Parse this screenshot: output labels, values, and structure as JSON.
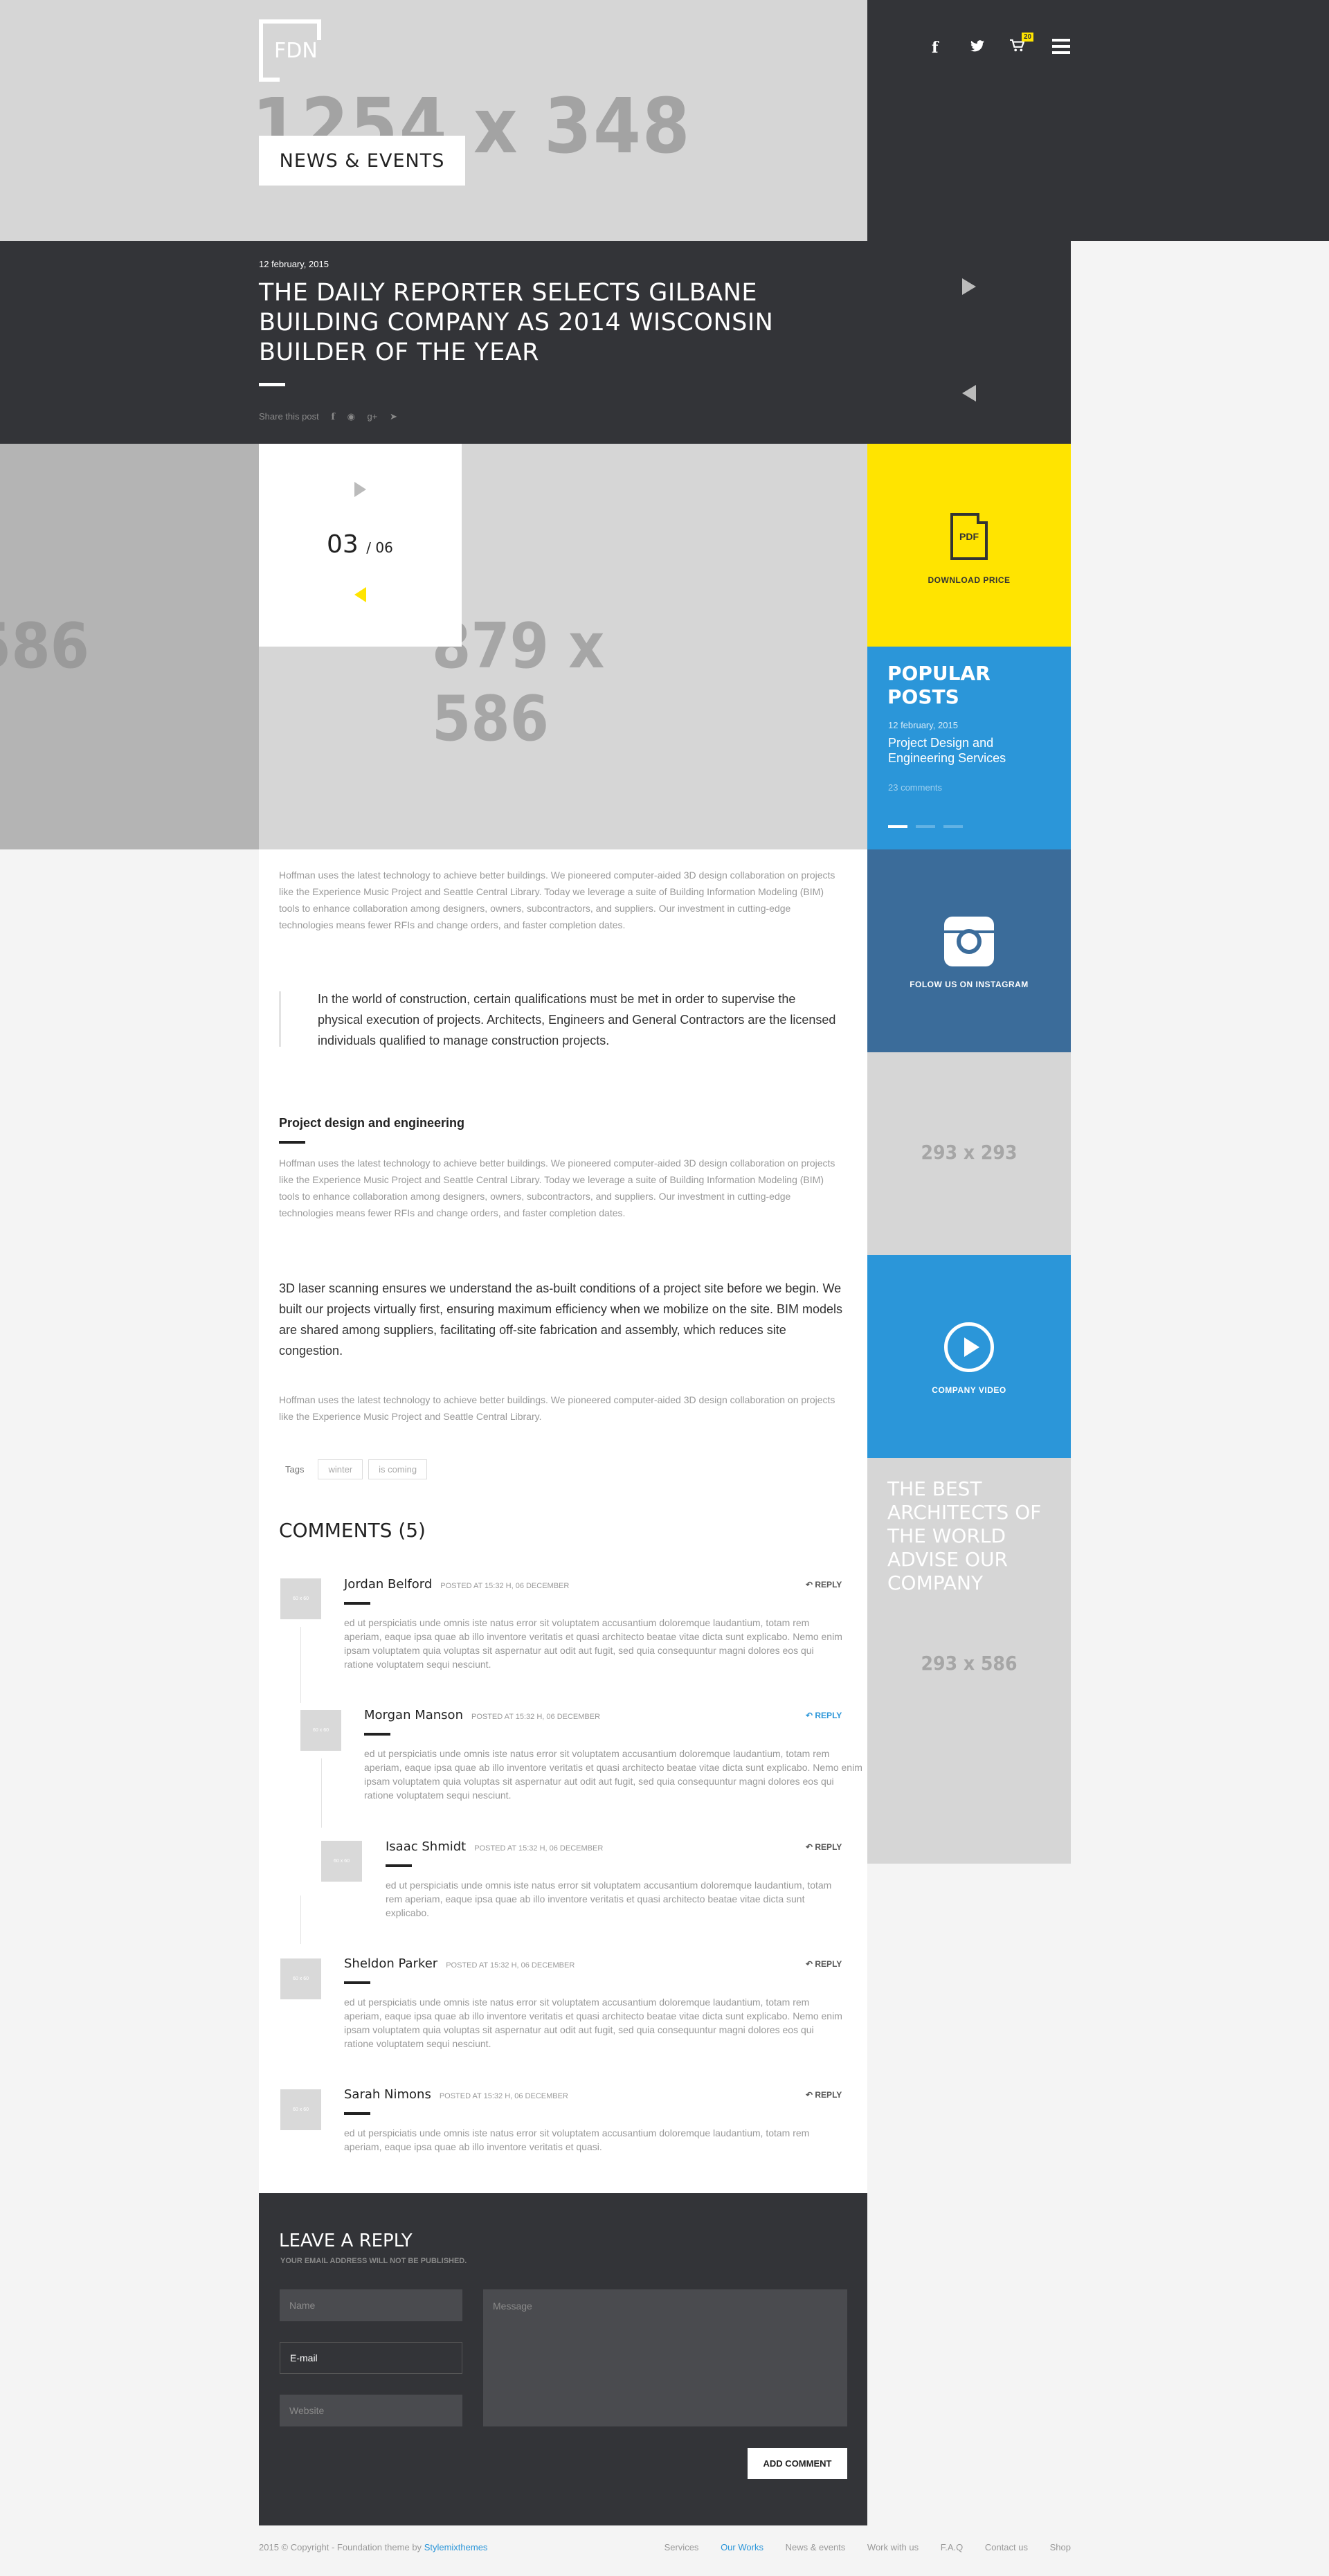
{
  "header": {
    "logo_text": "FDN",
    "hero_placeholder": "1254 x 348",
    "section_title": "NEWS & EVENTS",
    "cart_count": "20"
  },
  "post": {
    "date": "12 february, 2015",
    "title": "THE DAILY REPORTER SELECTS GILBANE BUILDING COMPANY AS 2014 WISCONSIN BUILDER OF THE YEAR",
    "share_label": "Share this post"
  },
  "gallery": {
    "left_placeholder": "586",
    "main_placeholder": "879 x 586",
    "counter_current": "03",
    "counter_total": "/ 06"
  },
  "sidebar": {
    "download_label": "DOWNLOAD PRICE",
    "pdf_label": "PDF",
    "popular_title_1": "POPULAR",
    "popular_title_2": "POSTS",
    "popular_date": "12 february, 2015",
    "popular_post": "Project Design and Engineering Services",
    "popular_comments": "23 comments",
    "instagram_label": "FOLOW US ON INSTAGRAM",
    "placeholder_1": "293 x 293",
    "video_label": "COMPANY VIDEO",
    "best_text": "THE BEST ARCHITECTS OF THE WORLD ADVISE OUR COMPANY",
    "placeholder_2": "293 x 586"
  },
  "article": {
    "p1": "Hoffman uses the latest technology to achieve better buildings. We pioneered computer-aided 3D design collaboration on projects like the Experience Music Project and Seattle Central Library. Today we leverage a suite of Building Information Modeling (BIM) tools to enhance collaboration among designers, owners, subcontractors, and suppliers. Our investment in cutting-edge technologies means fewer RFIs and change orders, and faster completion dates.",
    "blockquote": "In the world of construction, certain qualifications must be met in order to supervise the physical execution of projects. Architects, Engineers and General Contractors are the licensed individuals qualified to manage construction projects.",
    "section_heading": "Project design and engineering",
    "p2": "Hoffman uses the latest technology to achieve better buildings. We pioneered computer-aided 3D design collaboration on projects like the Experience Music Project and Seattle Central Library. Today we leverage a suite of Building Information Modeling (BIM) tools to enhance collaboration among designers, owners, subcontractors, and suppliers. Our investment in cutting-edge technologies means fewer RFIs and change orders, and faster completion dates.",
    "highlight": "3D laser scanning ensures we understand the as-built conditions of a project site before we begin. We built our projects virtually first, ensuring maximum efficiency when we mobilize on the site. BIM models are shared among suppliers, facilitating off-site fabrication and assembly, which reduces site congestion.",
    "p3": "Hoffman uses the latest technology to achieve better buildings. We pioneered computer-aided 3D design collaboration on projects like the Experience Music Project and Seattle Central Library.",
    "tags_label": "Tags",
    "tags": [
      "winter",
      "is coming"
    ]
  },
  "comments": {
    "heading": "COMMENTS (5)",
    "reply_label": "REPLY",
    "avatar_label": "60 x 60",
    "items": [
      {
        "name": "Jordan Belford",
        "meta": "POSTED AT 15:32 H, 06 DECEMBER",
        "body": "ed ut perspiciatis unde omnis iste natus error sit voluptatem accusantium doloremque laudantium, totam rem aperiam, eaque ipsa quae ab illo inventore veritatis et quasi architecto beatae vitae dicta sunt explicabo. Nemo enim ipsam voluptatem quia voluptas sit aspernatur aut odit aut fugit, sed quia consequuntur magni dolores eos qui ratione voluptatem sequi nesciunt."
      },
      {
        "name": "Morgan Manson",
        "meta": "POSTED AT 15:32 H, 06 DECEMBER",
        "body": "ed ut perspiciatis unde omnis iste natus error sit voluptatem accusantium doloremque laudantium, totam rem aperiam, eaque ipsa quae ab illo inventore veritatis et quasi architecto beatae vitae dicta sunt explicabo. Nemo enim ipsam voluptatem quia voluptas sit aspernatur aut odit aut fugit, sed quia consequuntur magni dolores eos qui ratione voluptatem sequi nesciunt."
      },
      {
        "name": "Isaac Shmidt",
        "meta": "POSTED AT 15:32 H, 06 DECEMBER",
        "body": "ed ut perspiciatis unde omnis iste natus error sit voluptatem accusantium doloremque laudantium, totam rem aperiam, eaque ipsa quae ab illo inventore veritatis et quasi architecto beatae vitae dicta sunt explicabo."
      },
      {
        "name": "Sheldon Parker",
        "meta": "POSTED AT 15:32 H, 06 DECEMBER",
        "body": "ed ut perspiciatis unde omnis iste natus error sit voluptatem accusantium doloremque laudantium, totam rem aperiam, eaque ipsa quae ab illo inventore veritatis et quasi architecto beatae vitae dicta sunt explicabo. Nemo enim ipsam voluptatem quia voluptas sit aspernatur aut odit aut fugit, sed quia consequuntur magni dolores eos qui ratione voluptatem sequi nesciunt."
      },
      {
        "name": "Sarah Nimons",
        "meta": "POSTED AT 15:32 H, 06 DECEMBER",
        "body": "ed ut perspiciatis unde omnis iste natus error sit voluptatem accusantium doloremque laudantium, totam rem aperiam, eaque ipsa quae ab illo inventore veritatis et quasi."
      }
    ]
  },
  "leave_reply": {
    "heading": "LEAVE A REPLY",
    "subheading": "YOUR EMAIL ADDRESS WILL NOT BE PUBLISHED.",
    "name_placeholder": "Name",
    "email_placeholder": "E-mail",
    "website_placeholder": "Website",
    "message_placeholder": "Message",
    "submit_label": "ADD COMMENT"
  },
  "footer": {
    "copyright": "2015 © Copyright - Foundation theme by",
    "brand": "Stylemixthemes",
    "nav": [
      "Services",
      "Our Works",
      "News & events",
      "Work with us",
      "F.A.Q",
      "Contact us",
      "Shop"
    ]
  },
  "colors": {
    "dark": "#333438",
    "yellow": "#ffe400",
    "blue": "#2b96d9",
    "instagram_blue": "#3b6c9a",
    "placeholder_gray": "#d6d6d6"
  }
}
